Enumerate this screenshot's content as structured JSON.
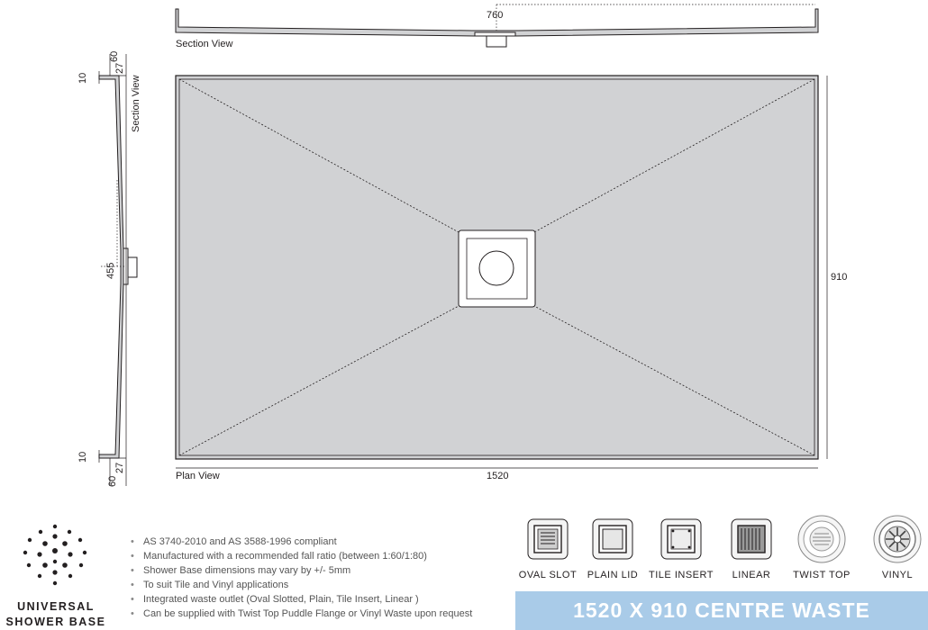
{
  "labels": {
    "section_view_top": "Section View",
    "section_view_side": "Section View",
    "plan_view": "Plan View"
  },
  "dimensions": {
    "top_760": "760",
    "right_910": "910",
    "bottom_1520": "1520",
    "side_455": "455",
    "side_10_top": "10",
    "side_60_top": "60",
    "side_27_top": "27",
    "side_10_bottom": "10",
    "side_60_bottom": "60",
    "side_27_bottom": "27"
  },
  "brand": {
    "line1": "UNIVERSAL",
    "line2": "SHOWER BASE"
  },
  "features": [
    "AS 3740-2010 and AS 3588-1996 compliant",
    "Manufactured with a recommended fall ratio (between 1:60/1:80)",
    "Shower Base dimensions may vary by +/- 5mm",
    "To suit Tile and Vinyl applications",
    "Integrated waste outlet (Oval Slotted, Plain, Tile Insert, Linear )",
    "Can be supplied with Twist Top Puddle Flange or Vinyl Waste upon request"
  ],
  "wastes": [
    {
      "label": "OVAL SLOT",
      "icon": "oval-slot-icon"
    },
    {
      "label": "PLAIN LID",
      "icon": "plain-lid-icon"
    },
    {
      "label": "TILE INSERT",
      "icon": "tile-insert-icon"
    },
    {
      "label": "LINEAR",
      "icon": "linear-icon"
    },
    {
      "label": "TWIST TOP",
      "icon": "twist-top-icon"
    },
    {
      "label": "VINYL",
      "icon": "vinyl-icon"
    }
  ],
  "banner": "1520 X 910 CENTRE WASTE",
  "colors": {
    "base_fill": "#d1d2d4",
    "outline": "#231f20",
    "banner": "#a9cbe8"
  }
}
